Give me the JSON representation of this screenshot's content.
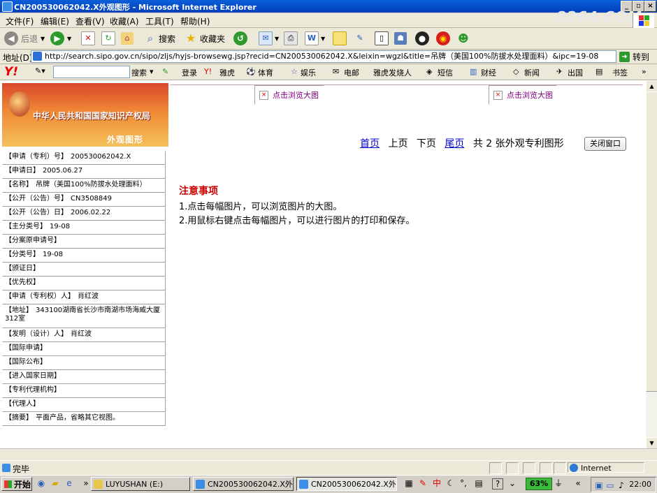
{
  "window": {
    "title": "CN200530062042.X外观图形 - Microsoft Internet Explorer",
    "brand_watermark": "8264.COM"
  },
  "menu": [
    "文件(F)",
    "编辑(E)",
    "查看(V)",
    "收藏(A)",
    "工具(T)",
    "帮助(H)"
  ],
  "toolbar": {
    "back": "后退",
    "search": "搜索",
    "favorites": "收藏夹"
  },
  "address": {
    "label": "地址(D)",
    "url": "http://search.sipo.gov.cn/sipo/zljs/hyjs-browsewg.jsp?recid=CN200530062042.X&leixin=wgzl&title=吊牌（美国100%防拔水处理面料）&ipc=19-08",
    "go": "转到"
  },
  "yahoo": {
    "logo": "Y!",
    "search_button": "搜索",
    "items": [
      "登录",
      "雅虎",
      "体育",
      "娱乐",
      "电邮",
      "雅虎发烧人",
      "短信",
      "财经",
      "新闻",
      "出国",
      "书签"
    ]
  },
  "banner": {
    "org": "中华人民共和国国家知识产权局",
    "subtitle": "外观图形"
  },
  "details": [
    {
      "key": "【申请（专利）号】",
      "value": "200530062042.X"
    },
    {
      "key": "【申请日】",
      "value": "2005.06.27"
    },
    {
      "key": "【名称】",
      "value": "吊牌（美国100%防拔水处理面料）"
    },
    {
      "key": "【公开（公告）号】",
      "value": "CN3508849"
    },
    {
      "key": "【公开（公告）日】",
      "value": "2006.02.22"
    },
    {
      "key": "【主分类号】",
      "value": "19-08"
    },
    {
      "key": "【分案原申请号】",
      "value": ""
    },
    {
      "key": "【分类号】",
      "value": "19-08"
    },
    {
      "key": "【颁证日】",
      "value": ""
    },
    {
      "key": "【优先权】",
      "value": ""
    },
    {
      "key": "【申请（专利权）人】",
      "value": "肖红波"
    },
    {
      "key": "【地址】",
      "value": "343100湖南省长沙市南湖市场海威大厦312室"
    },
    {
      "key": "【发明（设计）人】",
      "value": "肖红波"
    },
    {
      "key": "【国际申请】",
      "value": ""
    },
    {
      "key": "【国际公布】",
      "value": ""
    },
    {
      "key": "【进入国家日期】",
      "value": ""
    },
    {
      "key": "【专利代理机构】",
      "value": ""
    },
    {
      "key": "【代理人】",
      "value": ""
    },
    {
      "key": "【摘要】",
      "value": "平面产品，省略其它视图。"
    }
  ],
  "images": {
    "link1": "点击浏览大图",
    "link2": "点击浏览大图"
  },
  "pager": {
    "first": "首页",
    "prev": "上页",
    "next": "下页",
    "last": "尾页",
    "summary": "共 2 张外观专利图形",
    "close": "关闭窗口"
  },
  "notice": {
    "title": "注意事项",
    "lines": [
      "1.点击每幅图片，可以浏览图片的大图。",
      "2.用鼠标右键点击每幅图片，可以进行图片的打印和保存。"
    ]
  },
  "status": {
    "text": "完毕",
    "zone": "Internet"
  },
  "taskbar": {
    "start": "开始",
    "tasks": [
      "LUYUSHAN (E:)",
      "CN200530062042.X外...",
      "CN200530062042.X外..."
    ],
    "battery": "63%",
    "clock": "22:00"
  }
}
